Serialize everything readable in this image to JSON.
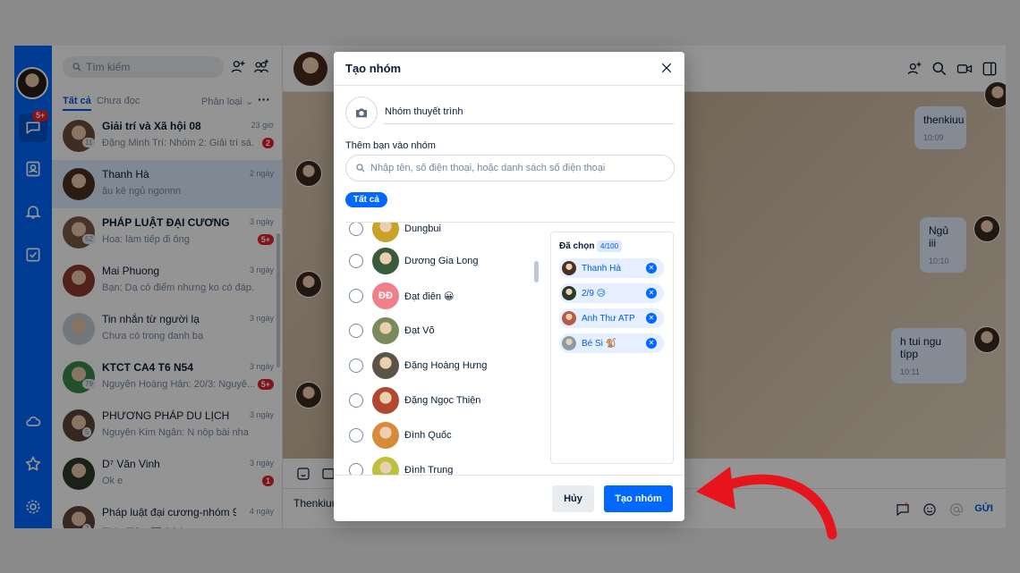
{
  "sidebar": {
    "search_placeholder": "Tìm kiếm",
    "nav_badge": "5+",
    "filter": {
      "all": "Tất cả",
      "unread": "Chưa đọc",
      "classify": "Phân loại",
      "more": "···"
    },
    "conversations": [
      {
        "name": "Giải trí và Xã hội 08",
        "msg": "Đặng Minh Trí: Nhóm 2: Giải trí sá...",
        "time": "23 giờ",
        "unread": "2",
        "count": "11",
        "bold": true,
        "avatar_color": "#6b4e3d"
      },
      {
        "name": "Thanh Hà",
        "msg": "ău kê ngủ ngonnn",
        "time": "2 ngày",
        "unread": "",
        "count": "",
        "bold": false,
        "avatar_color": "#4a2f22"
      },
      {
        "name": "PHÁP LUẬT ĐẠI CƯƠNG",
        "msg": "Hoa: làm tiếp đi ông",
        "time": "3 ngày",
        "unread": "5+",
        "count": "52",
        "bold": true,
        "avatar_color": "#7a5a46"
      },
      {
        "name": "Mai Phuong",
        "msg": "Bạn: Dạ có điểm nhưng ko có đáp...",
        "time": "3 ngày",
        "unread": "",
        "count": "",
        "bold": false,
        "avatar_color": "#8a3b2b"
      },
      {
        "name": "Tin nhắn từ người lạ",
        "msg": "Chưa có trong danh bạ",
        "time": "3 ngày",
        "unread": "",
        "count": "",
        "bold": false,
        "avatar_color": "#c4cdd6"
      },
      {
        "name": "KTCT CA4 T6 N54",
        "msg": "Nguyễn Hoàng Hân: 20/3: Nguyễ...",
        "time": "3 ngày",
        "unread": "5+",
        "count": "79",
        "bold": true,
        "avatar_color": "#3c8b4a"
      },
      {
        "name": "PHƯƠNG PHÁP DU LỊCH",
        "msg": "Nguyễn Kim Ngân: N nộp bài nha",
        "time": "3 ngày",
        "unread": "",
        "count": "5",
        "bold": false,
        "avatar_color": "#5a4438"
      },
      {
        "name": "D⁷ Văn Vinh",
        "msg": "Ok e",
        "time": "3 ngày",
        "unread": "1",
        "count": "",
        "bold": false,
        "avatar_color": "#2d3a2a"
      },
      {
        "name": "Pháp luật đại cương-nhóm 9",
        "msg": "Thùy Tiên: 🖾 Sticker",
        "time": "4 ngày",
        "unread": "",
        "count": "7",
        "bold": false,
        "avatar_color": "#5c463a"
      }
    ]
  },
  "chat": {
    "messages": [
      {
        "text": "thenkiuu",
        "time": "10:09"
      },
      {
        "text": "Ngủ iii",
        "time": "10:10"
      },
      {
        "text": "h tui ngu típp",
        "time": "10:11"
      }
    ],
    "input_text": "Thenkiuu",
    "send_label": "GỬI"
  },
  "modal": {
    "title": "Tạo nhóm",
    "group_name": "Nhóm thuyết trình",
    "add_label": "Thêm bạn vào nhóm",
    "search_placeholder": "Nhập tên, số điện thoại, hoặc danh sách số điện thoại",
    "chip_all": "Tất cả",
    "friends": [
      {
        "name": "Dungbui",
        "avatar_color": "#c9a227",
        "initials": ""
      },
      {
        "name": "Dương Gia Long",
        "avatar_color": "#3a5a3a",
        "initials": ""
      },
      {
        "name": "Đạt điên 😀",
        "avatar_color": "#f07f8a",
        "initials": "ĐĐ"
      },
      {
        "name": "Đạt Võ",
        "avatar_color": "#7b8a5a",
        "initials": ""
      },
      {
        "name": "Đặng Hoàng Hưng",
        "avatar_color": "#5b5346",
        "initials": ""
      },
      {
        "name": "Đặng Ngọc Thiện",
        "avatar_color": "#b0472e",
        "initials": ""
      },
      {
        "name": "Đình Quốc",
        "avatar_color": "#d68a3a",
        "initials": ""
      },
      {
        "name": "Đình Trung",
        "avatar_color": "#b8c23a",
        "initials": ""
      }
    ],
    "selected_title": "Đã chọn",
    "selected_count": "4/100",
    "selected": [
      {
        "name": "Thanh Hà",
        "avatar_color": "#4a2f22"
      },
      {
        "name": "2/9 😥",
        "avatar_color": "#2a3a2a"
      },
      {
        "name": "Anh Thư ATP",
        "avatar_color": "#b55a4a"
      },
      {
        "name": "Bé Si 🐒",
        "avatar_color": "#8a9aa8"
      }
    ],
    "cancel_label": "Hủy",
    "create_label": "Tạo nhóm"
  },
  "colors": {
    "brand": "#0068ff",
    "danger": "#e3222c",
    "annotation_arrow": "#e8141b"
  }
}
